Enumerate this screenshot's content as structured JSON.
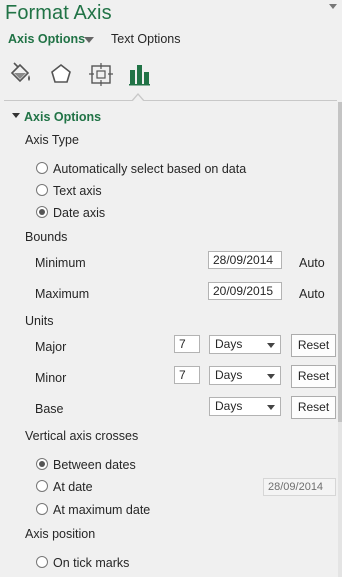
{
  "pane": {
    "title": "Format Axis",
    "tabs": [
      {
        "label": "Axis Options",
        "active": true
      },
      {
        "label": "Text Options",
        "active": false
      }
    ],
    "icons": [
      "fill-line-icon",
      "effects-icon",
      "size-properties-icon",
      "axis-options-icon"
    ]
  },
  "axis_options": {
    "header": "Axis Options",
    "axis_type": {
      "label": "Axis Type",
      "options": [
        {
          "label": "Automatically select based on data",
          "checked": false
        },
        {
          "label": "Text axis",
          "checked": false
        },
        {
          "label": "Date axis",
          "checked": true
        }
      ]
    },
    "bounds": {
      "label": "Bounds",
      "minimum": {
        "label": "Minimum",
        "value": "28/09/2014",
        "status": "Auto"
      },
      "maximum": {
        "label": "Maximum",
        "value": "20/09/2015",
        "status": "Auto"
      }
    },
    "units": {
      "label": "Units",
      "major": {
        "label": "Major",
        "value": "7",
        "unit": "Days",
        "button": "Reset"
      },
      "minor": {
        "label": "Minor",
        "value": "7",
        "unit": "Days",
        "button": "Reset"
      },
      "base": {
        "label": "Base",
        "unit": "Days",
        "button": "Reset"
      }
    },
    "vertical_axis_crosses": {
      "label": "Vertical axis crosses",
      "options": [
        {
          "label": "Between dates",
          "checked": true
        },
        {
          "label": "At date",
          "checked": false,
          "value": "28/09/2014"
        },
        {
          "label": "At maximum date",
          "checked": false
        }
      ]
    },
    "axis_position": {
      "label": "Axis position",
      "options": [
        {
          "label": "On tick marks",
          "checked": false
        }
      ]
    }
  },
  "colors": {
    "accent": "#217346",
    "background": "#f0f0f0"
  }
}
